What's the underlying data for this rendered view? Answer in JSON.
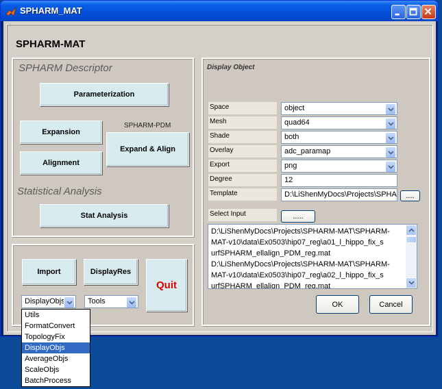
{
  "window": {
    "title": "SPHARM_MAT"
  },
  "app_title": "SPHARM-MAT",
  "descriptor": {
    "section_label": "SPHARM Descriptor",
    "parameterization": "Parameterization",
    "expansion": "Expansion",
    "alignment": "Alignment",
    "pdm_label": "SPHARM-PDM",
    "expand_align": "Expand & Align"
  },
  "stats": {
    "section_label": "Statistical Analysis",
    "stat_analysis": "Stat Analysis"
  },
  "bottom": {
    "import": "Import",
    "display_res": "DisplayRes",
    "quit": "Quit",
    "tool_select": "DisplayObjs",
    "tools_select": "Tools",
    "menu_items": [
      "Utils",
      "FormatConvert",
      "TopologyFix",
      "DisplayObjs",
      "AverageObjs",
      "ScaleObjs",
      "BatchProcess"
    ],
    "selected_index": 3
  },
  "display": {
    "title": "Display Object",
    "rows": [
      {
        "label": "Space",
        "value": "object",
        "type": "dropdown"
      },
      {
        "label": "Mesh",
        "value": "quad64",
        "type": "dropdown"
      },
      {
        "label": "Shade",
        "value": "both",
        "type": "dropdown"
      },
      {
        "label": "Overlay",
        "value": "adc_paramap",
        "type": "dropdown"
      },
      {
        "label": "Export",
        "value": "png",
        "type": "dropdown"
      },
      {
        "label": "Degree",
        "value": "12",
        "type": "text"
      },
      {
        "label": "Template",
        "value": "D:\\LiShenMyDocs\\Projects\\SPHARI",
        "type": "text"
      }
    ],
    "template_browse": "....",
    "select_input_label": "Select Input",
    "select_input_button": ".....",
    "input_lines": [
      "D:\\LiShenMyDocs\\Projects\\SPHARM-MAT\\SPHARM-",
      "MAT-v10\\data\\Ex0503\\hip07_reg\\a01_l_hippo_fix_s",
      "urfSPHARM_ellalign_PDM_reg.mat",
      "D:\\LiShenMyDocs\\Projects\\SPHARM-MAT\\SPHARM-",
      "MAT-v10\\data\\Ex0503\\hip07_reg\\a02_l_hippo_fix_s",
      "urfSPHARM_ellalign_PDM_reg.mat"
    ],
    "ok": "OK",
    "cancel": "Cancel"
  },
  "colors": {
    "accent": "#0a5ee8",
    "quit": "#e00000",
    "button_face": "#d8ebee",
    "panel": "#cfc8c0"
  }
}
